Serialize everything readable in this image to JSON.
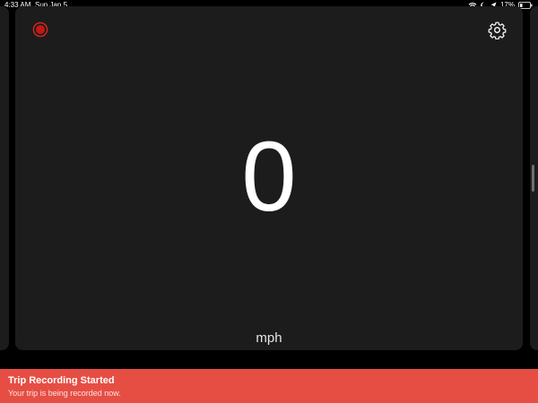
{
  "status_bar": {
    "time": "4:33 AM",
    "date": "Sun Jan 5",
    "battery_percent": "17%",
    "icons": [
      "wifi-icon",
      "moon-icon",
      "location-arrow-icon",
      "battery-icon"
    ]
  },
  "speedometer": {
    "speed": "0",
    "unit": "mph",
    "record_icon": "record-icon",
    "settings_icon": "gear-icon"
  },
  "toast": {
    "title": "Trip Recording Started",
    "message": "Your trip is being recorded now."
  },
  "colors": {
    "background": "#000000",
    "card": "#1c1c1c",
    "record_red": "#e0261d",
    "toast_red": "#e64e44",
    "text": "#ffffff"
  }
}
